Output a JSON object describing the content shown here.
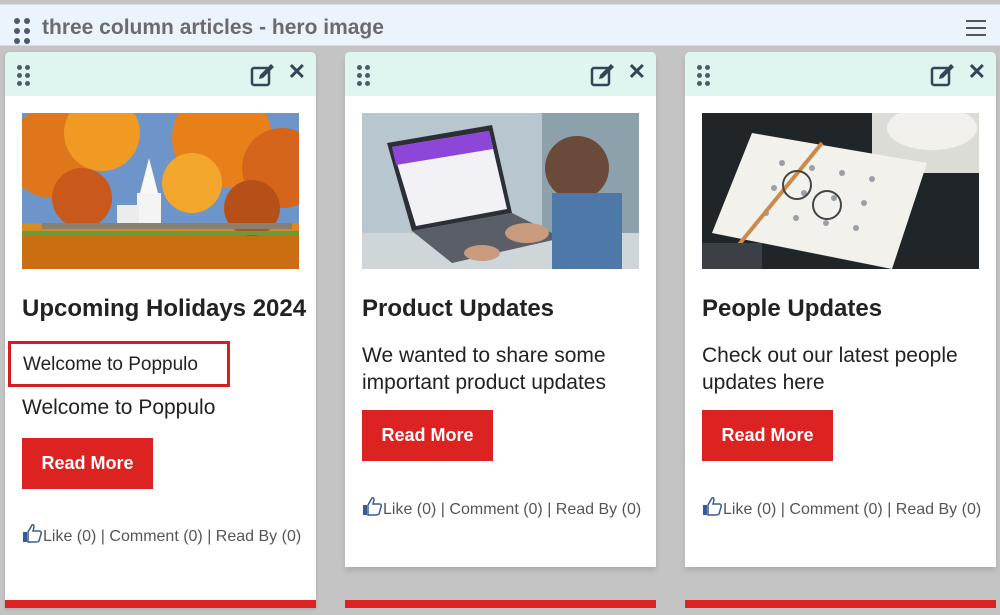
{
  "module": {
    "title": "three column articles - hero image",
    "grip_icon": "drag-handle-icon",
    "menu_icon": "hamburger-menu-icon"
  },
  "colors": {
    "header_bg": "#ebf3fc",
    "card_header_bg": "#dff6f0",
    "accent_red": "#dd2222",
    "page_bg": "#c4c4c4"
  },
  "cards": [
    {
      "title": "Upcoming Holidays 2024",
      "selected_text": "Welcome to Poppulo",
      "description": "Welcome to Poppulo",
      "button": "Read More",
      "social_like": "Like (0)",
      "social_rest": " | Comment (0) | Read By (0)",
      "image": "autumn-church-image"
    },
    {
      "title": "Product Updates",
      "description": "We wanted to share some important product updates",
      "button": "Read More",
      "social_like": "Like (0)",
      "social_rest": " | Comment (0) | Read By (0)",
      "image": "laptop-user-image"
    },
    {
      "title": "People Updates",
      "description": "Check out our latest people updates here",
      "button": "Read More",
      "social_like": "Like (0)",
      "social_rest": " | Comment (0) | Read By (0)",
      "image": "calendar-laptop-image"
    }
  ]
}
